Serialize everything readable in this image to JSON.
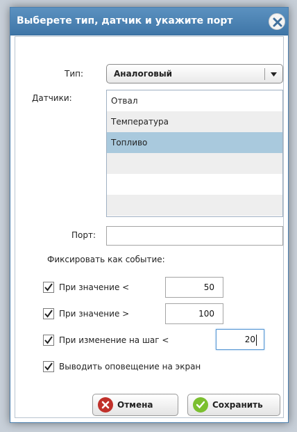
{
  "dialog": {
    "title": "Выберете тип, датчик и укажите порт",
    "close_icon": "close-icon"
  },
  "form": {
    "type_label": "Тип:",
    "type_value": "Аналоговый",
    "sensors_label": "Датчики:",
    "sensors": [
      "Отвал",
      "Температура",
      "Топливо",
      "",
      "",
      ""
    ],
    "selected_sensor": "Топливо",
    "port_label": "Порт:",
    "port_value": "",
    "event_header": "Фиксировать как событие:",
    "rules": [
      {
        "label": "При значение <",
        "value": "50",
        "checked": true
      },
      {
        "label": "При значение >",
        "value": "100",
        "checked": true
      },
      {
        "label": "При изменение на шаг <",
        "value": "20",
        "checked": true
      }
    ],
    "notify": {
      "label": "Выводить оповещение на экран",
      "checked": true
    }
  },
  "buttons": {
    "cancel_label": "Отмена",
    "save_label": "Сохранить"
  },
  "colors": {
    "titlebar": "#4a84b5",
    "selected_row": "#a9c9dd",
    "cancel_icon": "#c0302a",
    "save_icon": "#7bbf2f"
  }
}
